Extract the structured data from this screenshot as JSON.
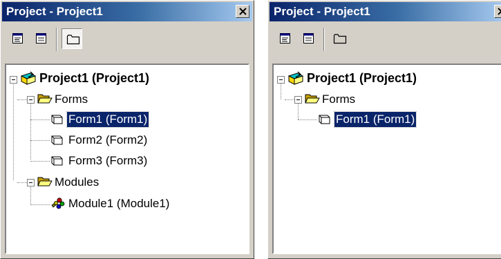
{
  "left": {
    "title": "Project - Project1",
    "tree": {
      "root_label": "Project1 (Project1)",
      "forms_label": "Forms",
      "forms": [
        "Form1 (Form1)",
        "Form2 (Form2)",
        "Form3 (Form3)"
      ],
      "selected": "Form1 (Form1)",
      "modules_label": "Modules",
      "modules": [
        "Module1 (Module1)"
      ]
    }
  },
  "right": {
    "title": "Project - Project1",
    "tree": {
      "root_label": "Project1 (Project1)",
      "forms_label": "Forms",
      "forms": [
        "Form1 (Form1)"
      ],
      "selected": "Form1 (Form1)"
    }
  },
  "toolbar": {
    "buttons": [
      "view-code-icon",
      "view-object-icon",
      "toggle-folders-icon"
    ]
  },
  "colors": {
    "titlebar_start": "#0a246a",
    "titlebar_end": "#a6caf0",
    "selection": "#0a246a",
    "chrome": "#d4d0c8"
  }
}
